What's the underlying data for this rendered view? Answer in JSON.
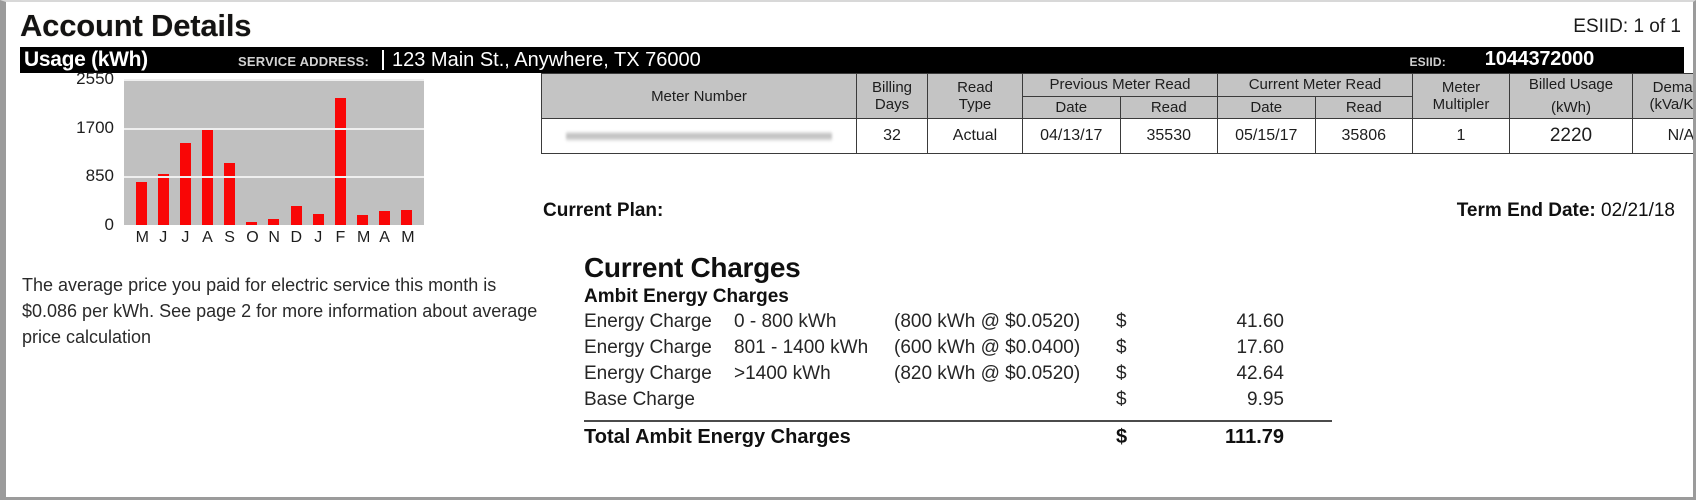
{
  "header": {
    "title": "Account Details",
    "esiid_count": "ESIID: 1 of 1"
  },
  "usage_bar": {
    "usage_label": "Usage (kWh)",
    "service_address_label": "SERVICE ADDRESS:",
    "service_address_value": "123 Main St., Anywhere, TX 76000",
    "esiid_label": "ESIID:",
    "esiid_value": "1044372000"
  },
  "chart_data": {
    "type": "bar",
    "title": "Usage (kWh)",
    "xlabel": "",
    "ylabel": "kWh",
    "categories": [
      "M",
      "J",
      "J",
      "A",
      "S",
      "O",
      "N",
      "D",
      "J",
      "F",
      "M",
      "A",
      "M"
    ],
    "values": [
      760,
      890,
      1430,
      1660,
      1090,
      60,
      110,
      340,
      190,
      2220,
      180,
      250,
      270
    ],
    "yticks": [
      0,
      850,
      1700,
      2550
    ],
    "ylim": [
      0,
      2550
    ],
    "grid": true,
    "bar_color": "#f90606",
    "plot_background": "#c0c0c0"
  },
  "avg_price_note": "The average price you paid for electric service this month is $0.086 per kWh. See page 2 for more information about average price calculation",
  "meter_table": {
    "headers": {
      "meter_number": "Meter Number",
      "billing_days": "Billing Days",
      "read_type": "Read Type",
      "previous_meter_read": "Previous Meter Read",
      "current_meter_read": "Current Meter Read",
      "meter_multiplier": "Meter Multipler",
      "billed_usage": "Billed Usage",
      "billed_usage_unit": "(kWh)",
      "demand": "Demand",
      "demand_unit": "(kVa/KW)",
      "date": "Date",
      "read": "Read"
    },
    "row": {
      "meter_number": "",
      "billing_days": "32",
      "read_type": "Actual",
      "previous_date": "04/13/17",
      "previous_read": "35530",
      "current_date": "05/15/17",
      "current_read": "35806",
      "meter_multiplier": "1",
      "billed_usage": "2220",
      "demand": "N/A"
    }
  },
  "plan": {
    "current_plan_label": "Current Plan:",
    "current_plan_value": "",
    "term_end_label": "Term End Date:",
    "term_end_value": "02/21/18"
  },
  "charges": {
    "title": "Current Charges",
    "subtitle": "Ambit Energy Charges",
    "currency_symbol": "$",
    "rows": [
      {
        "desc": "Energy Charge",
        "tier": "0 - 800 kWh",
        "calc": "(800 kWh @ $0.0520)",
        "currency": "$",
        "amount": "41.60"
      },
      {
        "desc": "Energy Charge",
        "tier": "801 - 1400 kWh",
        "calc": "(600 kWh @ $0.0400)",
        "currency": "$",
        "amount": "17.60"
      },
      {
        "desc": "Energy Charge",
        "tier": ">1400 kWh",
        "calc": "(820 kWh @ $0.0520)",
        "currency": "$",
        "amount": "42.64"
      },
      {
        "desc": "Base Charge",
        "tier": "",
        "calc": "",
        "currency": "$",
        "amount": "9.95"
      }
    ],
    "total_label": "Total Ambit Energy Charges",
    "total_currency": "$",
    "total_amount": "111.79"
  }
}
